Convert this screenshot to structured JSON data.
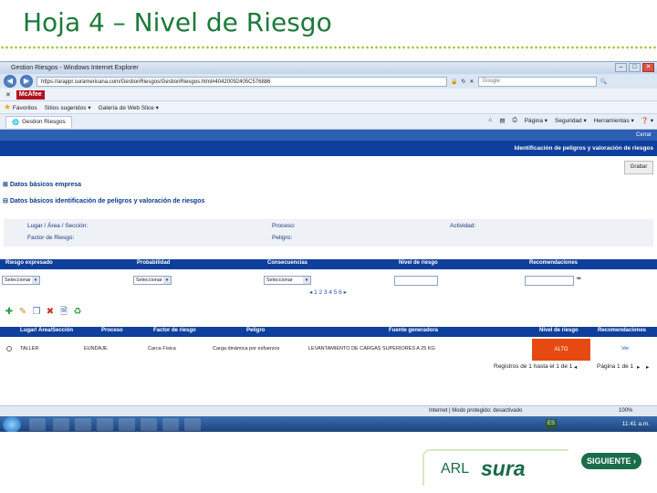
{
  "slide": {
    "title": "Hoja 4 – Nivel de Riesgo",
    "brand_arl": "ARL",
    "brand_sura": "sura",
    "next_button": "SIGUIENTE ›"
  },
  "browser": {
    "window_title": "Gestion Riesgos - Windows Internet Explorer",
    "url": "https://arappr.suramericana.com/GestionRiesgos/GestionRiesgos.html#40420092405C576886",
    "search_placeholder": "Google",
    "mcafee_label": "McAfee",
    "favorites": "Favoritos",
    "suggested_sites": "Sitios sugeridos ▾",
    "web_slice": "Galería de Web Slice ▾",
    "tab_label": "Gestion Riesgos",
    "tools": {
      "page": "Página ▾",
      "security": "Seguridad ▾",
      "utilities": "Herramientas ▾",
      "help": "❓ ▾"
    },
    "status_text": "Internet | Modo protegido: desactivado",
    "zoom": "100%",
    "taskbar_lang": "ES",
    "taskbar_time": "11:41 a.m."
  },
  "app": {
    "close_link": "Cerrar",
    "header_title": "Identificación de peligros y valoración de riesgos",
    "save_button": "Grabar",
    "section_company": "Datos básicos empresa",
    "section_identification": "Datos básicos identificación de peligros y valoración de riesgos",
    "info": {
      "place_label": "Lugar / Área / Sección:",
      "process_label": "Proceso:",
      "activity_label": "Actividad:",
      "risk_factor_label": "Factor de Riesgo:",
      "danger_label": "Peligro:"
    },
    "filters": {
      "expressed_risk": "Riesgo expresado",
      "probability": "Probabilidad",
      "consequences": "Consecuencias",
      "risk_level": "Nivel de riesgo",
      "recommendations": "Recomendaciones",
      "select_placeholder": "Seleccionar"
    },
    "pager": "◂ 1 2 3 4 5 6 ▸",
    "grid": {
      "headers": [
        "Lugar/ Área/Sección",
        "Proceso",
        "Factor de riesgo",
        "Peligro",
        "Fuente generadora",
        "Nivel de riesgo",
        "Recomendaciones"
      ],
      "row": {
        "place": "TALLER",
        "process": "EUNDAJE",
        "risk_factor": "Carca Física",
        "danger": "Carga dinámica por esfuerzos",
        "source": "LEVANTAMIENTO DE CARGAS SUPERIORES A 25 KG",
        "risk_level": "ALTO",
        "recommendations": "Ver"
      },
      "footer_records": "Registros de 1 hasta el 1 de 1",
      "footer_page": "Página 1 de 1"
    }
  },
  "colors": {
    "title_green": "#1b7a3a",
    "app_blue": "#0e3f9c",
    "risk_high": "#e64a10",
    "brand_green": "#1b6b48"
  }
}
